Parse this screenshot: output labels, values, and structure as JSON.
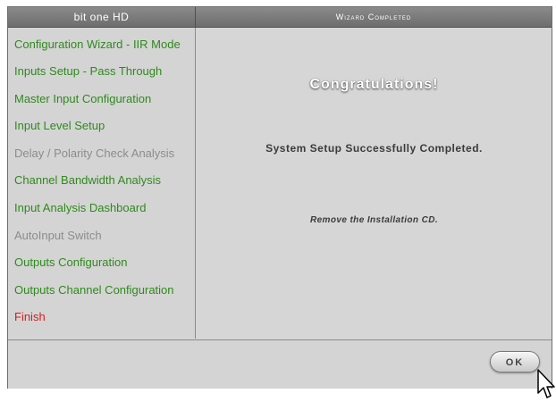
{
  "window": {
    "app_title": "bit one HD",
    "page_title": "Wizard Completed"
  },
  "sidebar": {
    "items": [
      {
        "label": "Configuration Wizard - IIR Mode",
        "state": "done",
        "color": "#2f8a1c"
      },
      {
        "label": "Inputs Setup - Pass Through",
        "state": "done",
        "color": "#2f8a1c"
      },
      {
        "label": "Master Input Configuration",
        "state": "done",
        "color": "#2f8a1c"
      },
      {
        "label": "Input Level Setup",
        "state": "done",
        "color": "#2f8a1c"
      },
      {
        "label": "Delay / Polarity Check Analysis",
        "state": "skipped",
        "color": "#8c8c8c"
      },
      {
        "label": "Channel Bandwidth Analysis",
        "state": "done",
        "color": "#2f8a1c"
      },
      {
        "label": "Input Analysis Dashboard",
        "state": "done",
        "color": "#2f8a1c"
      },
      {
        "label": "AutoInput Switch",
        "state": "skipped",
        "color": "#8c8c8c"
      },
      {
        "label": "Outputs Configuration",
        "state": "done",
        "color": "#2f8a1c"
      },
      {
        "label": "Outputs Channel Configuration",
        "state": "done",
        "color": "#2f8a1c"
      },
      {
        "label": "Finish",
        "state": "current",
        "color": "#d11f1f"
      }
    ]
  },
  "main": {
    "heading": "Congratulations!",
    "message": "System Setup Successfully Completed.",
    "note": "Remove the Installation CD."
  },
  "footer": {
    "ok_label": "OK"
  }
}
